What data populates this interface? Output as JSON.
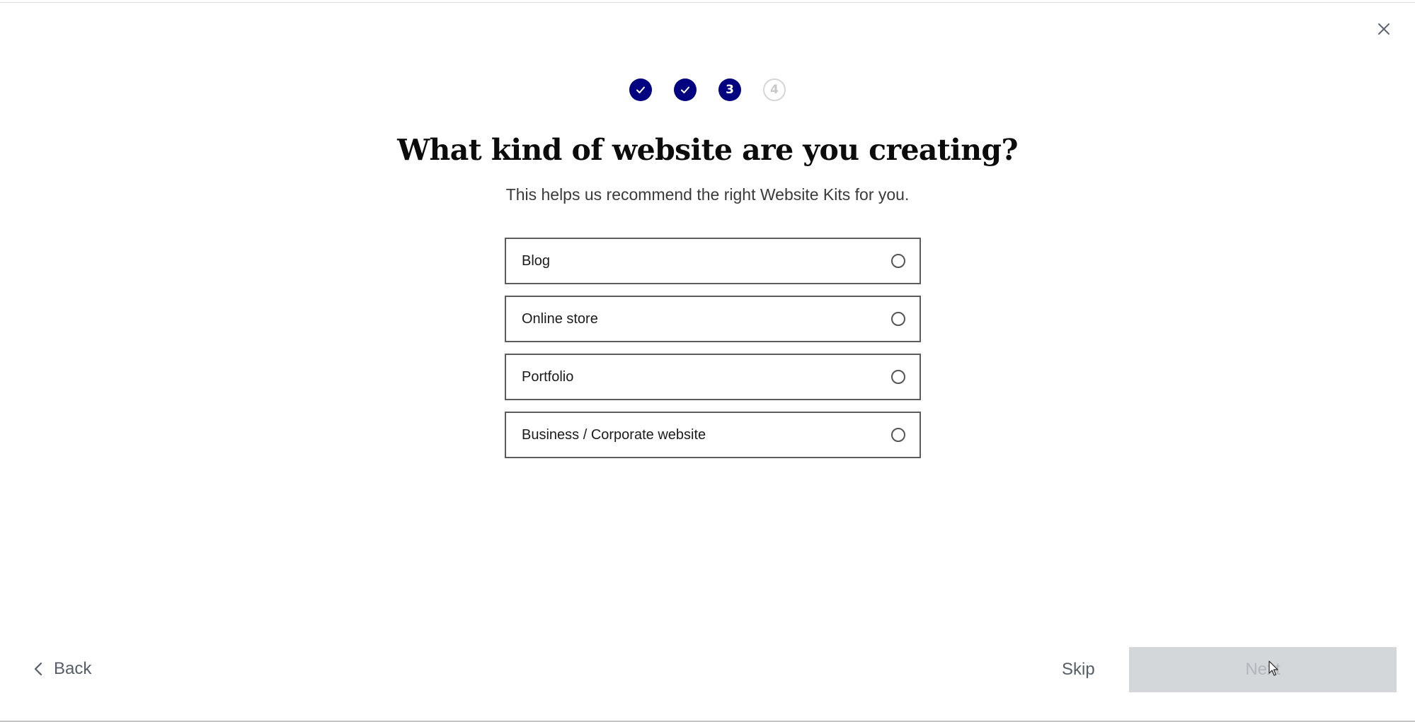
{
  "window": {
    "close_icon": "close-icon"
  },
  "stepper": {
    "steps": [
      {
        "label": "",
        "state": "done",
        "icon": "checkmark-icon"
      },
      {
        "label": "",
        "state": "done",
        "icon": "checkmark-icon"
      },
      {
        "label": "3",
        "state": "current"
      },
      {
        "label": "4",
        "state": "upcoming"
      }
    ],
    "current_step": 3,
    "total_steps": 4,
    "active_color": "#000080",
    "inactive_color": "#d6d6d6"
  },
  "header": {
    "title": "What kind of website are you creating?",
    "subtitle": "This helps us recommend the right Website Kits for you."
  },
  "options": [
    {
      "label": "Blog",
      "selected": false
    },
    {
      "label": "Online store",
      "selected": false
    },
    {
      "label": "Portfolio",
      "selected": false
    },
    {
      "label": "Business / Corporate website",
      "selected": false
    }
  ],
  "footer": {
    "back_label": "Back",
    "skip_label": "Skip",
    "next_label": "Next",
    "next_enabled": false
  }
}
